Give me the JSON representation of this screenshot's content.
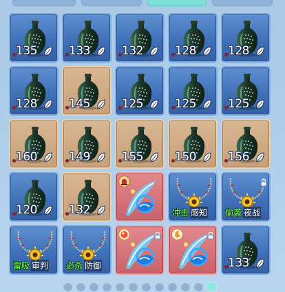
{
  "tabs": [
    {
      "label": ""
    },
    {
      "label": ""
    },
    {
      "label": "",
      "active": true
    },
    {
      "label": ""
    }
  ],
  "inventory": {
    "rows": [
      [
        {
          "kind": "bottle",
          "bg": "blue",
          "count": "135"
        },
        {
          "kind": "bottle",
          "bg": "blue",
          "count": "133"
        },
        {
          "kind": "bottle",
          "bg": "blue",
          "count": "132"
        },
        {
          "kind": "bottle",
          "bg": "blue",
          "count": "128"
        },
        {
          "kind": "bottle",
          "bg": "blue",
          "count": "128"
        }
      ],
      [
        {
          "kind": "bottle",
          "bg": "blue",
          "count": "128"
        },
        {
          "kind": "bottle",
          "bg": "tan",
          "count": "145"
        },
        {
          "kind": "bottle",
          "bg": "blue",
          "count": "125"
        },
        {
          "kind": "bottle",
          "bg": "blue",
          "count": "125"
        },
        {
          "kind": "bottle",
          "bg": "blue",
          "count": "125"
        }
      ],
      [
        {
          "kind": "bottle",
          "bg": "tan",
          "count": "160"
        },
        {
          "kind": "bottle",
          "bg": "tan",
          "count": "149"
        },
        {
          "kind": "bottle",
          "bg": "tan",
          "count": "155"
        },
        {
          "kind": "bottle",
          "bg": "tan",
          "count": "150"
        },
        {
          "kind": "bottle",
          "bg": "tan",
          "count": "156"
        }
      ],
      [
        {
          "kind": "bottle",
          "bg": "blue",
          "count": "120"
        },
        {
          "kind": "bottle",
          "bg": "tan",
          "count": "132"
        },
        {
          "kind": "sword",
          "bg": "red",
          "badge": "bell"
        },
        {
          "kind": "necklace",
          "bg": "blue",
          "tag_a": "冲击",
          "tag_b": "感知"
        },
        {
          "kind": "necklace",
          "bg": "blue",
          "tag_a": "偷袭",
          "tag_b": "夜战",
          "locked": true
        }
      ],
      [
        {
          "kind": "necklace",
          "bg": "blue",
          "tag_a": "雷吸",
          "tag_b": "审判"
        },
        {
          "kind": "necklace",
          "bg": "blue",
          "tag_a": "必杀",
          "tag_b": "防御"
        },
        {
          "kind": "sword",
          "bg": "red",
          "badge": "orb",
          "locked": true
        },
        {
          "kind": "sword",
          "bg": "red",
          "badge": "moon",
          "locked": true
        },
        {
          "kind": "bottle",
          "bg": "blue",
          "count": "133"
        }
      ]
    ]
  },
  "pager": {
    "pages": 12,
    "current": 11
  },
  "colors": {
    "accent": "#8fe8df",
    "tag_green": "#7dff52"
  }
}
